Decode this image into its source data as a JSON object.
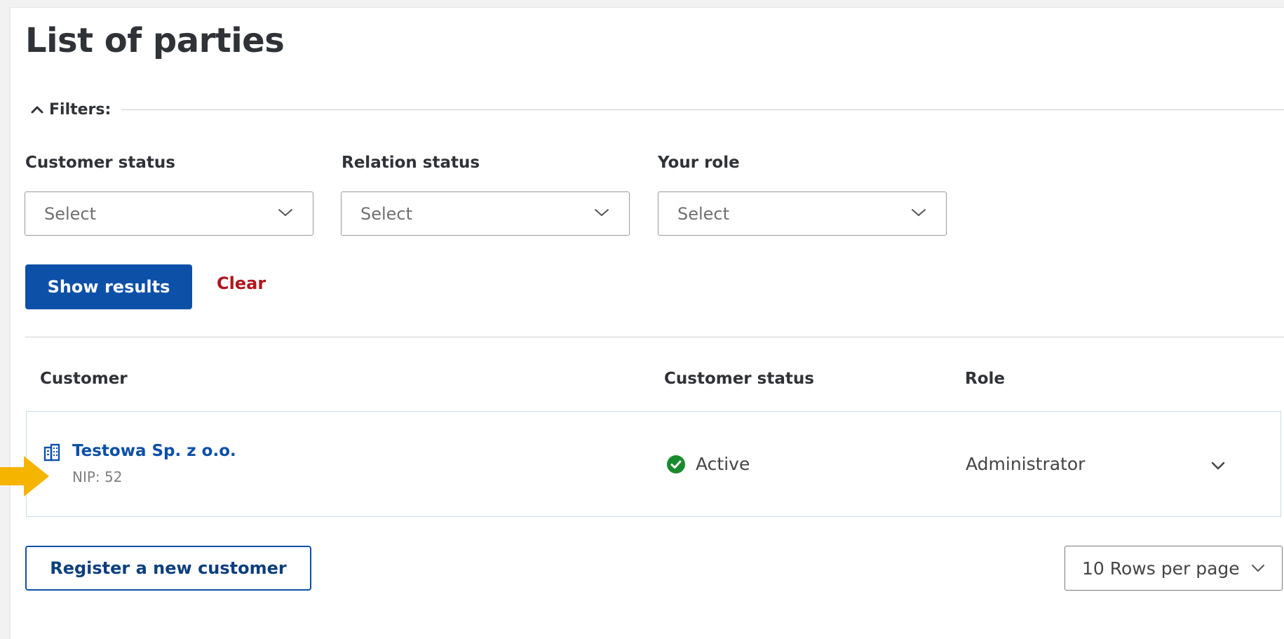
{
  "page": {
    "title": "List of parties"
  },
  "filters": {
    "toggle_label": "Filters:",
    "customer_status": {
      "label": "Customer status",
      "value": "Select"
    },
    "relation_status": {
      "label": "Relation status",
      "value": "Select"
    },
    "your_role": {
      "label": "Your role",
      "value": "Select"
    },
    "show_results_label": "Show results",
    "clear_label": "Clear"
  },
  "table": {
    "columns": [
      "Customer",
      "Customer status",
      "Role"
    ],
    "rows": [
      {
        "name": "Testowa Sp. z o.o.",
        "nip": "NIP: 52",
        "status": "Active",
        "role": "Administrator"
      }
    ]
  },
  "footer": {
    "register_label": "Register a new customer",
    "rows_per_page": "10 Rows per page"
  },
  "colors": {
    "primary": "#0d50a8",
    "danger": "#b0151d",
    "success": "#1a8a2e",
    "arrow": "#f5b400"
  }
}
